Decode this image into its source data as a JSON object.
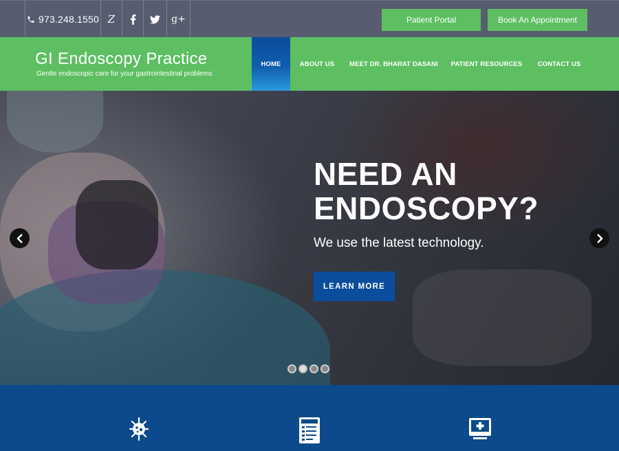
{
  "topbar": {
    "phone": "973.248.1550",
    "social_icons": [
      "phone-icon",
      "zocdoc-icon",
      "facebook-icon",
      "twitter-icon",
      "google-plus-icon"
    ],
    "zocdoc_glyph": "Z",
    "google_glyph": "g+",
    "patient_portal_label": "Patient Portal",
    "book_label": "Book An Appointment"
  },
  "header": {
    "title": "GI Endoscopy Practice",
    "tagline": "Gentle endoscopic care for your gastrointestinal problems",
    "nav": [
      {
        "label": "HOME",
        "active": true
      },
      {
        "label": "ABOUT US",
        "active": false
      },
      {
        "label": "MEET DR. BHARAT DASANI",
        "active": false
      },
      {
        "label": "PATIENT RESOURCES",
        "active": false
      },
      {
        "label": "CONTACT US",
        "active": false
      }
    ]
  },
  "hero": {
    "heading_line1": "NEED AN",
    "heading_line2": "ENDOSCOPY?",
    "subheading": "We use the latest technology.",
    "cta_label": "LEARN MORE",
    "slide_count": 4,
    "active_slide": 2
  },
  "features": {
    "icons": [
      "virus-icon",
      "checklist-document-icon",
      "medical-monitor-icon"
    ]
  },
  "colors": {
    "green": "#5dbf62",
    "topbar": "#565d6f",
    "blue": "#0a4d9c",
    "feature_band": "#0c4a8c"
  }
}
